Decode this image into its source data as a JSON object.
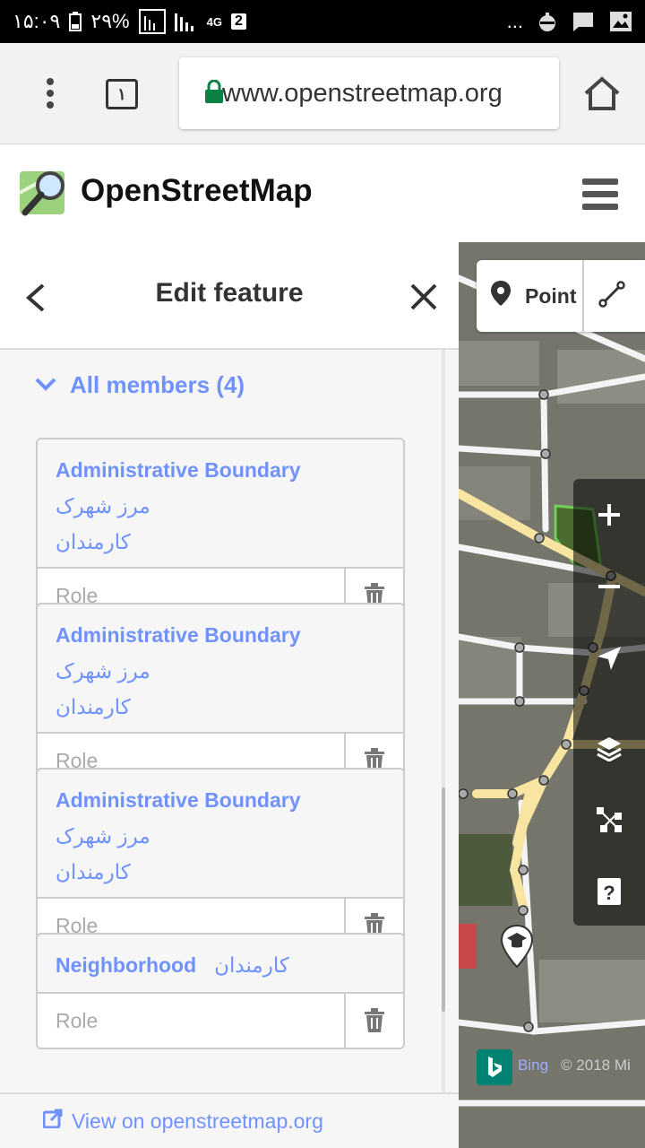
{
  "status_bar": {
    "time": "۱۵:۰۹",
    "battery": "۲۹%",
    "network": "4G",
    "sim": "2",
    "dots": "..."
  },
  "browser": {
    "tab_count": "۱",
    "url": "www.openstreetmap.org"
  },
  "header": {
    "title": "OpenStreetMap"
  },
  "sidebar": {
    "title": "Edit feature",
    "members_toggle": "All members (4)",
    "members": [
      {
        "type": "Administrative Boundary",
        "name": "مرز شهرک",
        "name2": "کارمندان",
        "role_placeholder": "Role"
      },
      {
        "type": "Administrative Boundary",
        "name": "مرز شهرک",
        "name2": "کارمندان",
        "role_placeholder": "Role"
      },
      {
        "type": "Administrative Boundary",
        "name": "مرز شهرک",
        "name2": "کارمندان",
        "role_placeholder": "Role"
      },
      {
        "type": "Neighborhood",
        "name": "کارمندان",
        "name2": "",
        "role_placeholder": "Role"
      }
    ],
    "footer_link": "View on openstreetmap.org"
  },
  "map": {
    "toolbar": {
      "point_label": "Point"
    },
    "attribution": {
      "bing": "Bing",
      "copyright": "© 2018 Mi"
    },
    "colors": {
      "accent": "#7092ff",
      "bing_green": "#008373",
      "road": "#f7e5a1"
    }
  }
}
